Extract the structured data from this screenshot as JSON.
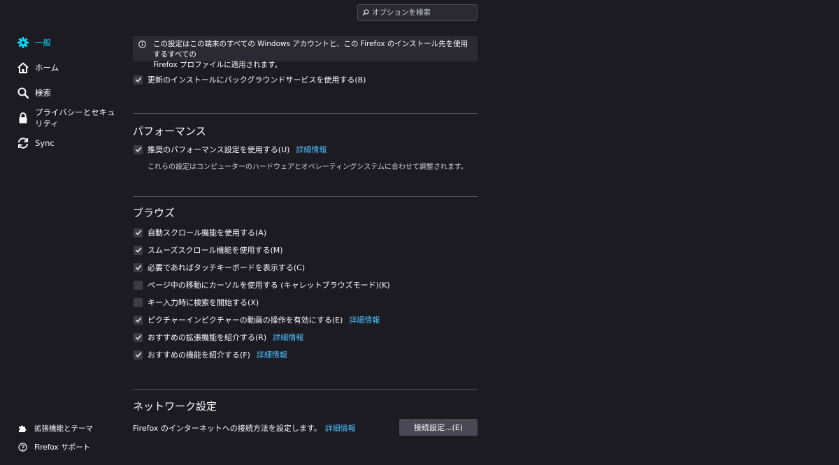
{
  "search": {
    "placeholder": "オプションを検索"
  },
  "colors": {
    "accent": "#00ddff",
    "link": "#4cc0ff",
    "background": "#1c1b22",
    "panel": "#2b2a33"
  },
  "sidebar": {
    "items": [
      {
        "label": "一般",
        "icon": "gear-icon",
        "active": true
      },
      {
        "label": "ホーム",
        "icon": "home-icon"
      },
      {
        "label": "検索",
        "icon": "search-icon"
      },
      {
        "label": "プライバシーとセキュリティ",
        "icon": "lock-icon"
      },
      {
        "label": "Sync",
        "icon": "sync-icon"
      }
    ],
    "footer": [
      {
        "label": "拡張機能とテーマ",
        "icon": "puzzle-icon"
      },
      {
        "label": "Firefox サポート",
        "icon": "help-icon"
      }
    ]
  },
  "updates": {
    "info_line1": "この設定はこの端末のすべての Windows アカウントと、この Firefox のインストール先を使用するすべての",
    "info_line2": "Firefox プロファイルに適用されます。",
    "background_service": {
      "label": "更新のインストールにバックグラウンドサービスを使用する(B)",
      "checked": true
    }
  },
  "performance": {
    "title": "パフォーマンス",
    "recommended": {
      "label": "推奨のパフォーマンス設定を使用する(U)",
      "checked": true,
      "link": "詳細情報"
    },
    "description": "これらの設定はコンピューターのハードウェアとオペレーティングシステムに合わせて調整されます。"
  },
  "browsing": {
    "title": "ブラウズ",
    "options": [
      {
        "label": "自動スクロール機能を使用する(A)",
        "checked": true
      },
      {
        "label": "スムーズスクロール機能を使用する(M)",
        "checked": true
      },
      {
        "label": "必要であればタッチキーボードを表示する(C)",
        "checked": true
      },
      {
        "label": "ページ中の移動にカーソルを使用する (キャレットブラウズモード)(K)",
        "checked": false
      },
      {
        "label": "キー入力時に検索を開始する(X)",
        "checked": false
      },
      {
        "label": "ピクチャーインピクチャーの動画の操作を有効にする(E)",
        "checked": true,
        "link": "詳細情報"
      },
      {
        "label": "おすすめの拡張機能を紹介する(R)",
        "checked": true,
        "link": "詳細情報"
      },
      {
        "label": "おすすめの機能を紹介する(F)",
        "checked": true,
        "link": "詳細情報"
      }
    ]
  },
  "network": {
    "title": "ネットワーク設定",
    "description": "Firefox のインターネットへの接続方法を設定します。",
    "link": "詳細情報",
    "button": "接続設定...(E)"
  }
}
